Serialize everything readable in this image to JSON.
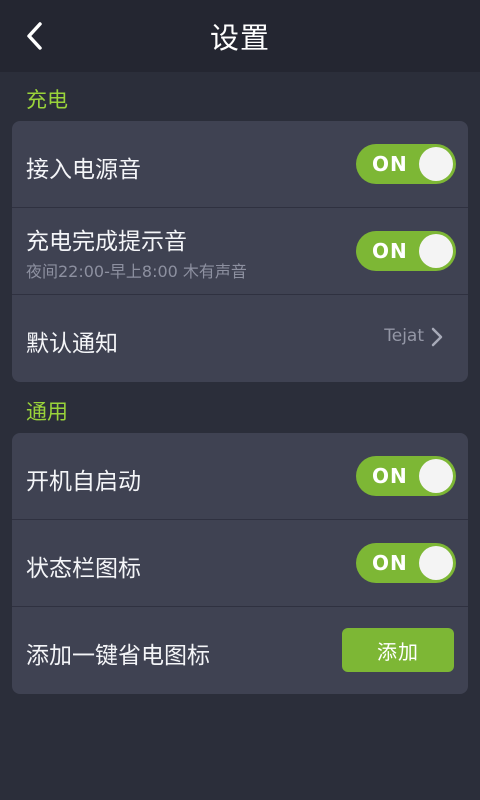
{
  "header": {
    "title": "设置",
    "back_icon": "chevron-left-icon"
  },
  "sections": {
    "charging": {
      "title": "充电",
      "rows": {
        "power_sound": {
          "label": "接入电源音",
          "toggle": "ON"
        },
        "complete_sound": {
          "label": "充电完成提示音",
          "sub": "夜间22:00-早上8:00 木有声音",
          "toggle": "ON"
        },
        "default_notice": {
          "label": "默认通知",
          "value": "Tejat",
          "chevron_icon": "chevron-right-icon"
        }
      }
    },
    "general": {
      "title": "通用",
      "rows": {
        "autostart": {
          "label": "开机自启动",
          "toggle": "ON"
        },
        "statusbar_icon": {
          "label": "状态栏图标",
          "toggle": "ON"
        },
        "add_shortcut": {
          "label": "添加一键省电图标",
          "button": "添加"
        }
      }
    }
  },
  "colors": {
    "accent": "#7db735",
    "section_title": "#9ad43a",
    "background": "#2b2e3a",
    "card": "#3f4252",
    "header": "#242631"
  }
}
